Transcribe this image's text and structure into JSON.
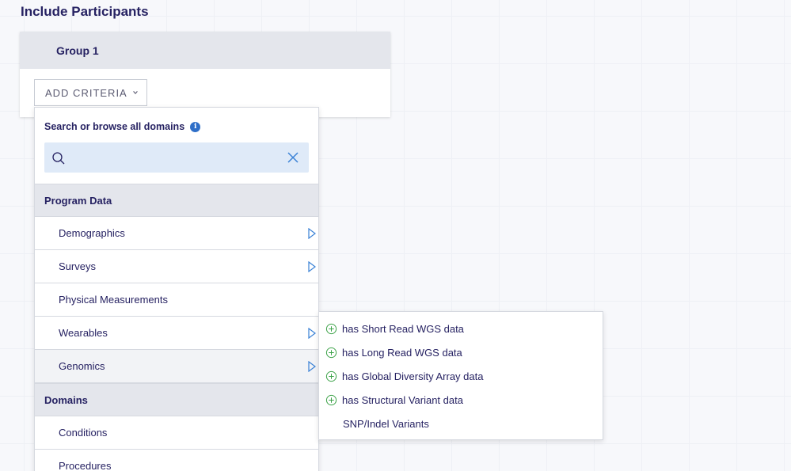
{
  "page": {
    "title": "Include Participants"
  },
  "group": {
    "title": "Group 1",
    "add_criteria_label": "ADD CRITERIA"
  },
  "dropdown": {
    "search_label": "Search or browse all domains",
    "search_value": "",
    "search_placeholder": "",
    "sections": [
      {
        "title": "Program Data",
        "items": [
          {
            "label": "Demographics",
            "has_submenu": true
          },
          {
            "label": "Surveys",
            "has_submenu": true
          },
          {
            "label": "Physical Measurements",
            "has_submenu": false
          },
          {
            "label": "Wearables",
            "has_submenu": true
          },
          {
            "label": "Genomics",
            "has_submenu": true,
            "active": true
          }
        ]
      },
      {
        "title": "Domains",
        "items": [
          {
            "label": "Conditions",
            "has_submenu": false
          },
          {
            "label": "Procedures",
            "has_submenu": false
          }
        ]
      }
    ]
  },
  "submenu": {
    "items": [
      {
        "label": "has Short Read WGS data",
        "icon": "add-circle-icon"
      },
      {
        "label": "has Long Read WGS data",
        "icon": "add-circle-icon"
      },
      {
        "label": "has Global Diversity Array data",
        "icon": "add-circle-icon"
      },
      {
        "label": "has Structural Variant data",
        "icon": "add-circle-icon"
      },
      {
        "label": "SNP/Indel Variants",
        "icon": ""
      }
    ]
  },
  "colors": {
    "title": "#262262",
    "info": "#2f6fc8",
    "add_icon": "#3ea34a",
    "arrow": "#3b82d6",
    "search_bg": "#dfeaf8"
  }
}
